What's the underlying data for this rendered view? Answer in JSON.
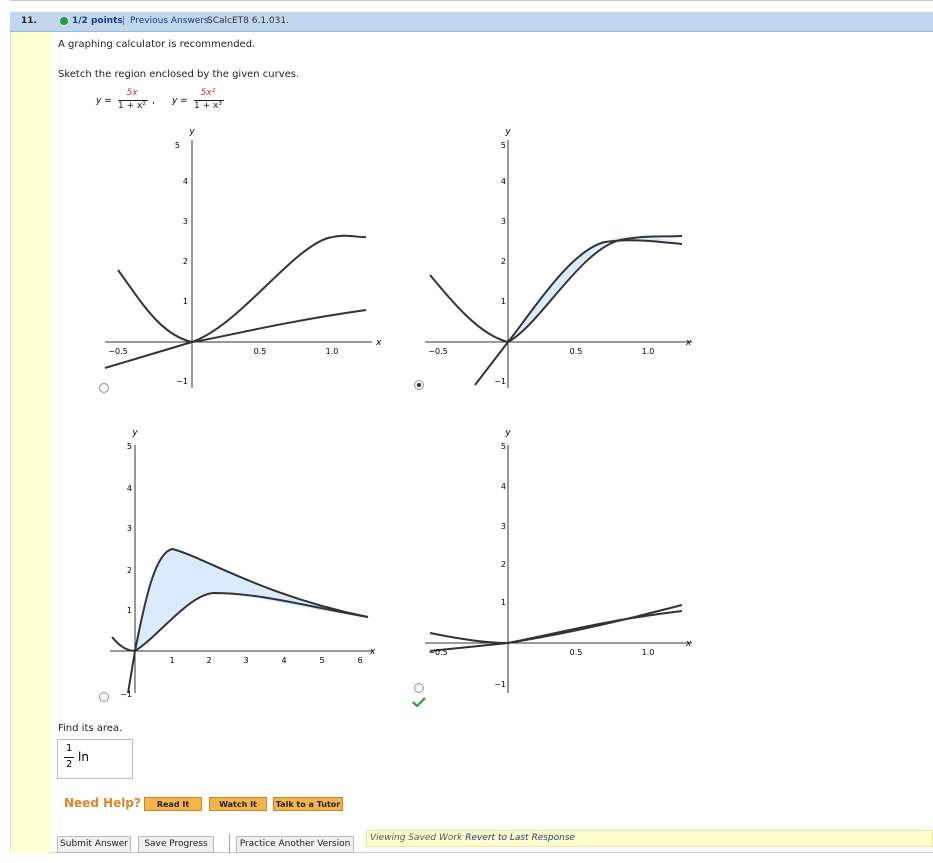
{
  "header": {
    "number": "11.",
    "points": "1/2 points",
    "separator": "|",
    "previous_answers": "Previous Answers",
    "code": "SCalcET8 6.1.031."
  },
  "question": {
    "recommend": "A graphing calculator is recommended.",
    "instruction": "Sketch the region enclosed by the given curves.",
    "y_eq": "y =",
    "f1_num": "5x",
    "f1_den": "1 + x²",
    "f2_num": "5x²",
    "f2_den": "1 + x³",
    "comma": ","
  },
  "plot_labels": {
    "x": "x",
    "y": "y",
    "tick_5": "5",
    "tick_4": "4",
    "tick_3": "3",
    "tick_2": "2",
    "tick_1": "1",
    "tick_m1": "−1",
    "tick_m05": "−0.5",
    "tick_05": "0.5",
    "tick_10": "1.0",
    "tick_x1": "1",
    "tick_x2": "2",
    "tick_x3": "3",
    "tick_x4": "4",
    "tick_x5": "5",
    "tick_x6": "6"
  },
  "choices": [
    {
      "selected": false
    },
    {
      "selected": true
    },
    {
      "selected": false
    },
    {
      "selected": false,
      "correct": true
    }
  ],
  "area": {
    "prompt": "Find its area.",
    "answer_num": "1",
    "answer_den": "2",
    "answer_ln": "ln"
  },
  "help": {
    "label": "Need Help?",
    "read": "Read It",
    "watch": "Watch It",
    "tutor": "Talk to a Tutor"
  },
  "footer": {
    "submit": "Submit Answer",
    "save": "Save Progress",
    "practice": "Practice Another Version",
    "viewing": "Viewing Saved Work",
    "revert": "Revert to Last Response"
  },
  "colors": {
    "header_bg": "#c0d7ee",
    "left_bar": "#ffffd2",
    "region_fill": "#dbeafe",
    "help_orange": "#e2842a",
    "correct_green": "#3aa84a"
  }
}
